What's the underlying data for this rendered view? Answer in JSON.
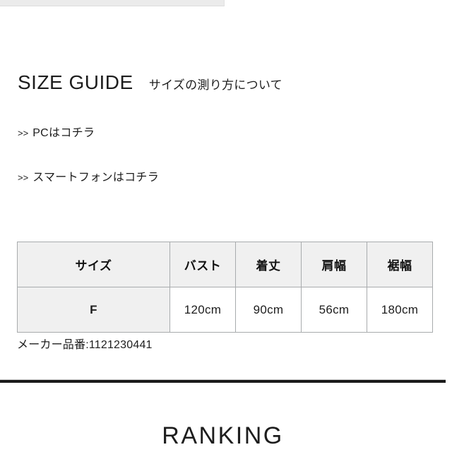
{
  "section": {
    "heading_en": "SIZE GUIDE",
    "heading_ja": "サイズの測り方について"
  },
  "links": [
    {
      "arrows": ">>",
      "label": "PCはコチラ"
    },
    {
      "arrows": ">>",
      "label": "スマートフォンはコチラ"
    }
  ],
  "size_table": {
    "headers": [
      "サイズ",
      "バスト",
      "着丈",
      "肩幅",
      "裾幅"
    ],
    "rows": [
      [
        "F",
        "120cm",
        "90cm",
        "56cm",
        "180cm"
      ]
    ]
  },
  "maker": {
    "label_and_value": "メーカー品番:1121230441"
  },
  "next_section": {
    "heading": "RANKING"
  },
  "colors": {
    "text": "#1d1d1d",
    "table_border": "#a8abad",
    "table_header_bg": "#f0f0f0",
    "divider": "#1a1a1a",
    "top_bar_bg": "#ebebeb"
  }
}
